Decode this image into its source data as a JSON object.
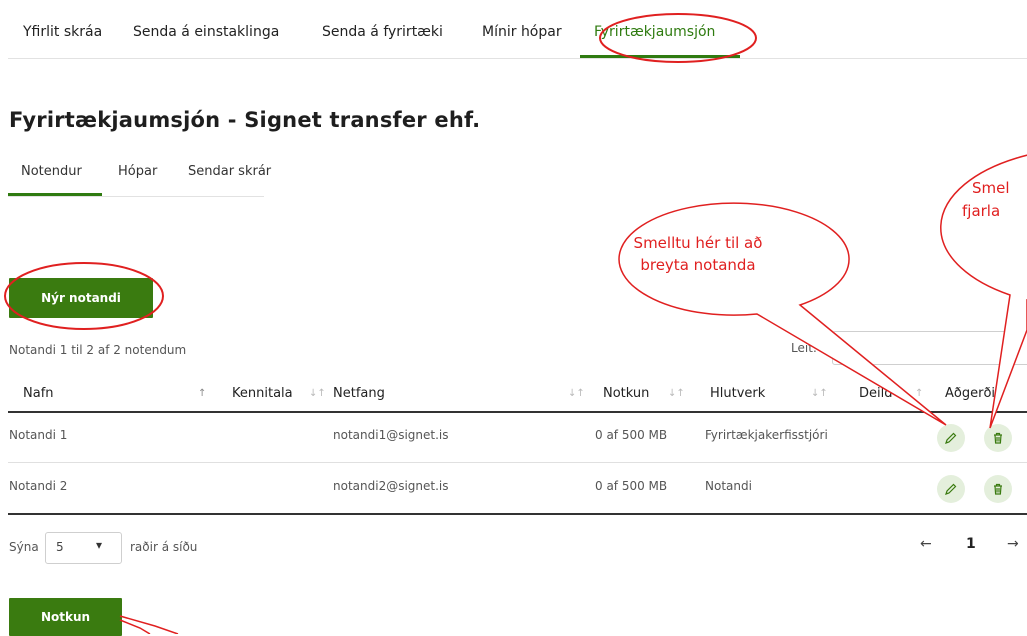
{
  "nav": {
    "tabs": [
      {
        "label": "Yfirlit skráa"
      },
      {
        "label": "Senda á einstaklinga"
      },
      {
        "label": "Senda á fyrirtæki"
      },
      {
        "label": "Mínir hópar"
      },
      {
        "label": "Fyrirtækjaumsjón"
      }
    ],
    "active_index": 4
  },
  "page": {
    "title": "Fyrirtækjaumsjón - Signet transfer ehf."
  },
  "subtabs": [
    {
      "label": "Notendur"
    },
    {
      "label": "Hópar"
    },
    {
      "label": "Sendar skrár"
    }
  ],
  "new_user_button": "Nýr notandi",
  "table_info": "Notandi 1 til 2 af 2 notendum",
  "search": {
    "label": "Leit:",
    "value": ""
  },
  "table": {
    "columns": [
      "Nafn",
      "Kennitala",
      "Netfang",
      "Notkun",
      "Hlutverk",
      "Deild",
      "Aðgerðir"
    ],
    "rows": [
      {
        "name": "Notandi 1",
        "kennitala": "",
        "email": "notandi1@signet.is",
        "usage": "0 af 500 MB",
        "role": "Fyrirtækjakerfisstjóri",
        "dept": ""
      },
      {
        "name": "Notandi 2",
        "kennitala": "",
        "email": "notandi2@signet.is",
        "usage": "0 af 500 MB",
        "role": "Notandi",
        "dept": ""
      }
    ]
  },
  "page_size": {
    "label": "Sýna",
    "value": "5",
    "suffix": "raðir á síðu"
  },
  "pagination": {
    "prev": "←",
    "current": "1",
    "next": "→"
  },
  "usage_button": "Notkun",
  "annotations": {
    "edit_line1": "Smelltu hér til að",
    "edit_line2": "breyta notanda",
    "delete_line1": "Smel",
    "delete_line2": "fjarla"
  },
  "colors": {
    "accent": "#3a7b10",
    "annotation": "#e02020"
  },
  "icons": [
    "pencil-icon",
    "trash-icon",
    "chevron-down-icon",
    "arrow-left-icon",
    "arrow-right-icon"
  ]
}
